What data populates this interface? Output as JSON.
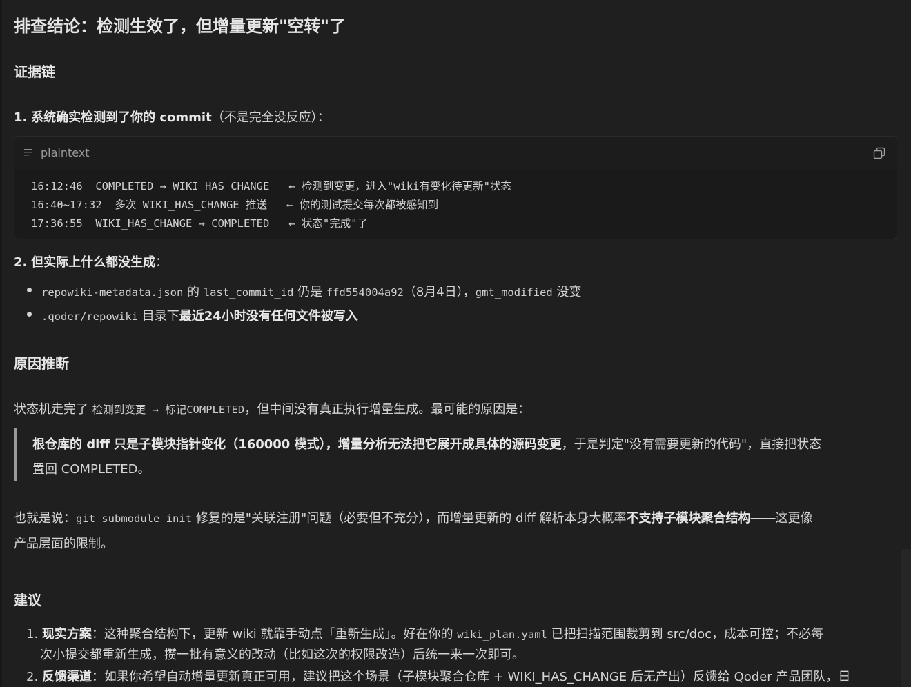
{
  "title": "排查结论：检测生效了，但增量更新\"空转\"了",
  "evidence": {
    "heading": "证据链",
    "item1": {
      "num": "1.",
      "bold": "系统确实检测到了你的 commit",
      "rest": "（不是完全没反应）："
    },
    "code": {
      "lang": "plaintext",
      "lines": [
        "16:12:46  COMPLETED → WIKI_HAS_CHANGE   ← 检测到变更，进入\"wiki有变化待更新\"状态",
        "16:40~17:32  多次 WIKI_HAS_CHANGE 推送   ← 你的测试提交每次都被感知到",
        "17:36:55  WIKI_HAS_CHANGE → COMPLETED   ← 状态\"完成\"了"
      ]
    },
    "item2": {
      "num": "2.",
      "bold": "但实际上什么都没生成",
      "rest": "："
    },
    "bullets": [
      {
        "c1": "repowiki-metadata.json",
        "t1": " 的 ",
        "c2": "last_commit_id",
        "t2": " 仍是 ",
        "c3": "ffd554004a92",
        "t3": "（8月4日），",
        "c4": "gmt_modified",
        "t4": " 没变"
      },
      {
        "c1": ".qoder/repowiki",
        "t1": " 目录下",
        "b1": "最近24小时没有任何文件被写入"
      }
    ]
  },
  "cause": {
    "heading": "原因推断",
    "p1": {
      "t1": "状态机走完了 ",
      "c1": "检测到变更 → 标记COMPLETED",
      "t2": "，但中间没有真正执行增量生成。最可能的原因是："
    },
    "quote": {
      "b1": "根仓库的 diff 只是子模块指针变化（160000 模式），增量分析无法把它展开成具体的源码变更",
      "t1": "，于是判定\"没有需要更新的代码\"，直接把状态",
      "line2": "置回 COMPLETED。"
    },
    "p2": {
      "t1": "也就是说：",
      "c1": "git submodule init",
      "t2": " 修复的是\"关联注册\"问题（必要但不充分），而增量更新的 diff 解析本身大概率",
      "b1": "不支持子模块聚合结构",
      "s1": "——",
      "t3": "这更像",
      "line2": "产品层面的限制。"
    }
  },
  "advice": {
    "heading": "建议",
    "items": [
      {
        "num": "1.",
        "bold": "现实方案",
        "t1": "：这种聚合结构下，更新 wiki 就靠手动点「重新生成」。好在你的 ",
        "c1": "wiki_plan.yaml",
        "t2": " 已把扫描范围裁剪到 src/doc，成本可控；不必每",
        "line2": "次小提交都重新生成，攒一批有意义的改动（比如这次的权限改造）后统一来一次即可。"
      },
      {
        "num": "2.",
        "bold": "反馈渠道",
        "t1": "：如果你希望自动增量更新真正可用，建议把这个场景（子模块聚合仓库 + WIKI_HAS_CHANGE 后无产出）反馈给 Qoder 产品团队，日"
      }
    ]
  }
}
